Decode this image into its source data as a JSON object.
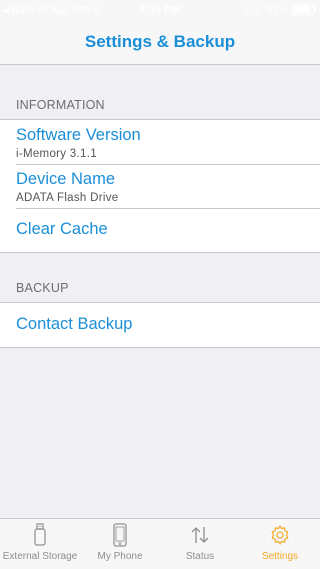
{
  "status_bar": {
    "back_label": "Back to App Store",
    "time": "3:16 PM",
    "battery": "91%"
  },
  "nav": {
    "title": "Settings & Backup"
  },
  "information": {
    "header": "INFORMATION",
    "software_version": {
      "title": "Software Version",
      "value": "i-Memory 3.1.1"
    },
    "device_name": {
      "title": "Device Name",
      "value": "ADATA Flash Drive"
    },
    "clear_cache": {
      "title": "Clear Cache"
    }
  },
  "backup": {
    "header": "BACKUP",
    "contact_backup": {
      "title": "Contact Backup"
    }
  },
  "tabs": [
    {
      "label": "External Storage",
      "icon": "usb-drive-icon"
    },
    {
      "label": "My Phone",
      "icon": "phone-icon"
    },
    {
      "label": "Status",
      "icon": "transfer-arrows-icon"
    },
    {
      "label": "Settings",
      "icon": "gear-icon",
      "active": true
    }
  ],
  "colors": {
    "accent": "#1a8fd8",
    "active_tab": "#f5a623"
  }
}
